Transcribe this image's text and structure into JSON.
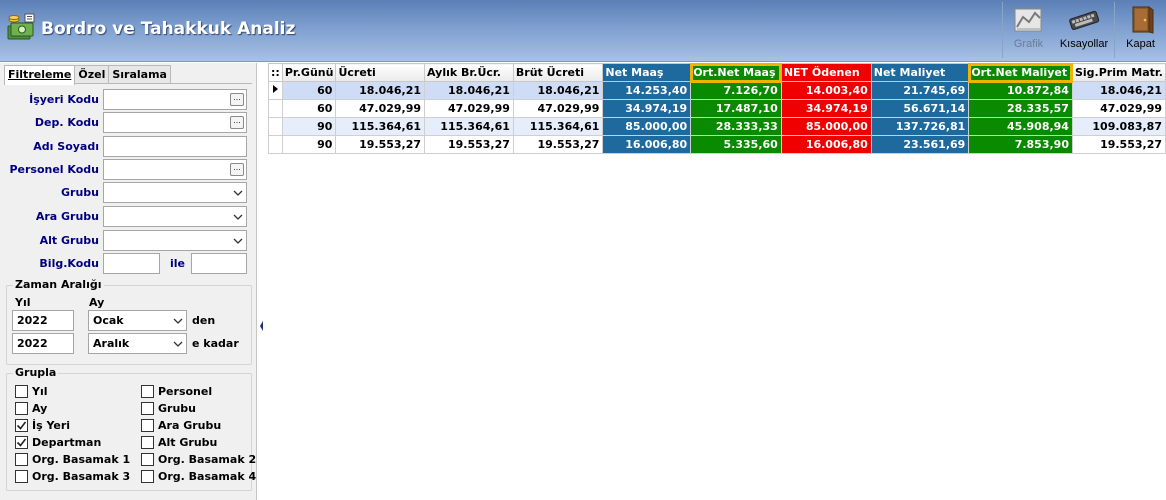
{
  "window": {
    "title": "Bordro ve Tahakkuk Analiz"
  },
  "toolbar": {
    "grafik_label": "Grafik",
    "kisayollar_label": "Kısayollar",
    "kapat_label": "Kapat"
  },
  "tabs": [
    {
      "label": "Filtreleme",
      "active": true
    },
    {
      "label": "Özel",
      "active": false
    },
    {
      "label": "Sıralama",
      "active": false
    }
  ],
  "filters": {
    "isyeri_kodu": {
      "label": "İşyeri Kodu",
      "value": ""
    },
    "dep_kodu": {
      "label": "Dep. Kodu",
      "value": ""
    },
    "adi_soyadi": {
      "label": "Adı Soyadı",
      "value": ""
    },
    "personel_kodu": {
      "label": "Personel Kodu",
      "value": ""
    },
    "grubu": {
      "label": "Grubu",
      "value": ""
    },
    "ara_grubu": {
      "label": "Ara Grubu",
      "value": ""
    },
    "alt_grubu": {
      "label": "Alt Grubu",
      "value": ""
    },
    "bilg_kodu": {
      "label": "Bilg.Kodu",
      "from": "",
      "to": "",
      "ile": "ile"
    },
    "ellipsis": "..."
  },
  "zaman": {
    "title": "Zaman Aralığı",
    "yil_label": "Yıl",
    "ay_label": "Ay",
    "start_year": "2022",
    "start_month": "Ocak",
    "den": "den",
    "end_year": "2022",
    "end_month": "Aralık",
    "e_kadar": "e kadar"
  },
  "grupla": {
    "title": "Grupla",
    "items": [
      {
        "label": "Yıl",
        "checked": false
      },
      {
        "label": "Personel",
        "checked": false
      },
      {
        "label": "Ay",
        "checked": false
      },
      {
        "label": "Grubu",
        "checked": false
      },
      {
        "label": "İş Yeri",
        "checked": true
      },
      {
        "label": "Ara Grubu",
        "checked": false
      },
      {
        "label": "Departman",
        "checked": true
      },
      {
        "label": "Alt Grubu",
        "checked": false
      },
      {
        "label": "Org. Basamak 1",
        "checked": false
      },
      {
        "label": "Org. Basamak 2",
        "checked": false
      },
      {
        "label": "Org. Basamak 3",
        "checked": false
      },
      {
        "label": "Org. Basamak 4",
        "checked": false
      }
    ]
  },
  "grid": {
    "indicator_header": "::",
    "columns": [
      {
        "label": "Pr.Günü",
        "style": ""
      },
      {
        "label": "Ücreti",
        "style": ""
      },
      {
        "label": "Aylık Br.Ücr.",
        "style": ""
      },
      {
        "label": "Brüt Ücreti",
        "style": ""
      },
      {
        "label": "Net Maaş",
        "style": "blue"
      },
      {
        "label": "Ort.Net Maaş",
        "style": "green"
      },
      {
        "label": "NET Ödenen",
        "style": "red"
      },
      {
        "label": "Net Maliyet",
        "style": "blue"
      },
      {
        "label": "Ort.Net Maliyet",
        "style": "green"
      },
      {
        "label": "Sig.Prim Matr.",
        "style": ""
      }
    ],
    "rows": [
      [
        "60",
        "18.046,21",
        "18.046,21",
        "18.046,21",
        "14.253,40",
        "7.126,70",
        "14.003,40",
        "21.745,69",
        "10.872,84",
        "18.046,21"
      ],
      [
        "60",
        "47.029,99",
        "47.029,99",
        "47.029,99",
        "34.974,19",
        "17.487,10",
        "34.974,19",
        "56.671,14",
        "28.335,57",
        "47.029,99"
      ],
      [
        "90",
        "115.364,61",
        "115.364,61",
        "115.364,61",
        "85.000,00",
        "28.333,33",
        "85.000,00",
        "137.726,81",
        "45.908,94",
        "109.083,87"
      ],
      [
        "90",
        "19.553,27",
        "19.553,27",
        "19.553,27",
        "16.006,80",
        "5.335,60",
        "16.006,80",
        "23.561,69",
        "7.853,90",
        "19.553,27"
      ]
    ]
  },
  "colors": {
    "title_gradient_top": "#5b7fb6",
    "header_blue": "#1e6a9e",
    "header_green": "#0a8a00",
    "header_red": "#f00000",
    "highlight_outline": "#f0b400"
  }
}
